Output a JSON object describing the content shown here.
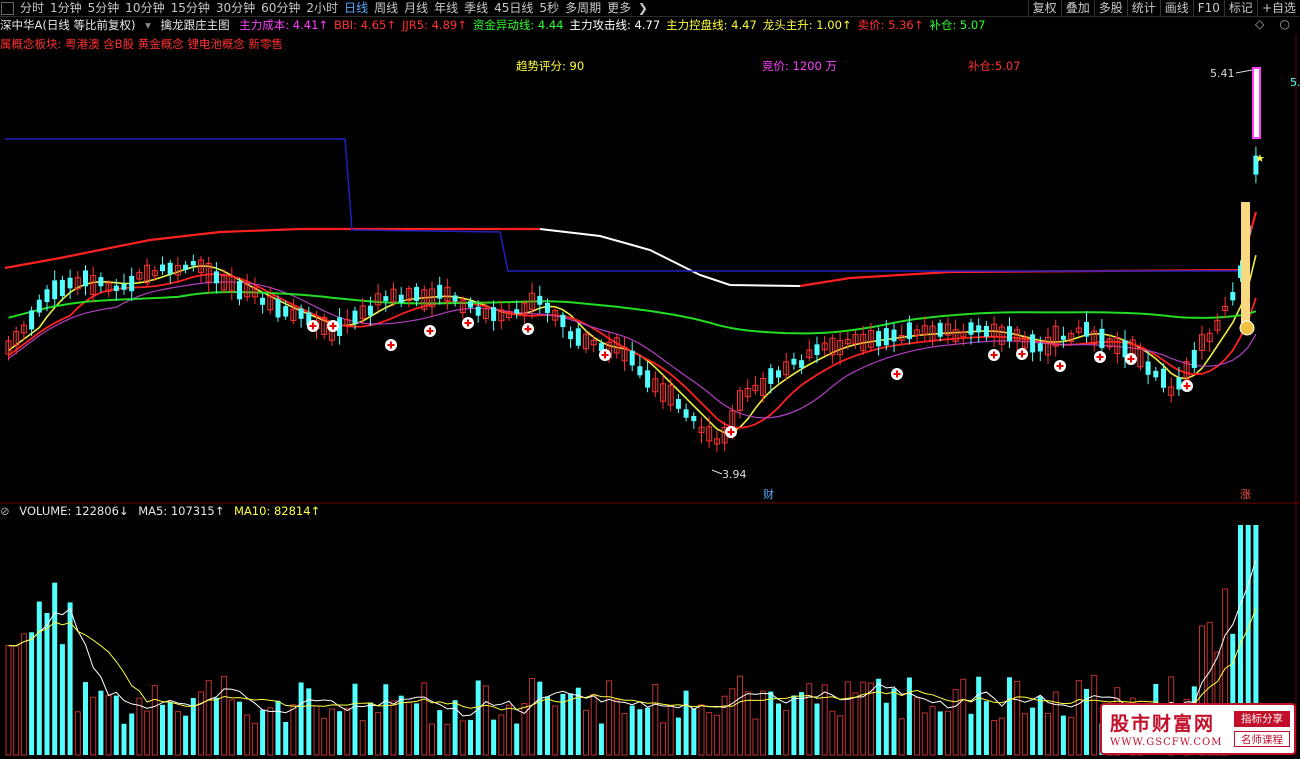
{
  "toolbar": {
    "periods": [
      {
        "label": "分时"
      },
      {
        "label": "1分钟"
      },
      {
        "label": "5分钟"
      },
      {
        "label": "10分钟"
      },
      {
        "label": "15分钟"
      },
      {
        "label": "30分钟"
      },
      {
        "label": "60分钟"
      },
      {
        "label": "2小时"
      },
      {
        "label": "日线"
      },
      {
        "label": "周线"
      },
      {
        "label": "月线"
      },
      {
        "label": "年线"
      },
      {
        "label": "季线"
      },
      {
        "label": "45日线"
      },
      {
        "label": "5秒"
      },
      {
        "label": "多周期"
      },
      {
        "label": "更多"
      }
    ],
    "active_period": "日线",
    "right_buttons": [
      "复权",
      "叠加",
      "多股",
      "统计",
      "画线",
      "F10",
      "标记",
      "+自选"
    ]
  },
  "info": {
    "stock": "深中华A(日线 等比前复权)",
    "indicator_name": "擒龙跟庄主图",
    "items": [
      {
        "label": "主力成本: 4.41↑",
        "color": "#ff40ff"
      },
      {
        "label": "BBI: 4.65↑",
        "color": "#ff3030"
      },
      {
        "label": "JJR5: 4.89↑",
        "color": "#ff3030"
      },
      {
        "label": "资金异动线: 4.44",
        "color": "#30ff30"
      },
      {
        "label": "主力攻击线: 4.77",
        "color": "#ffffff"
      },
      {
        "label": "主力控盘线: 4.47",
        "color": "#ffff40"
      },
      {
        "label": "龙头主升: 1.00↑",
        "color": "#ffff40"
      },
      {
        "label": "卖价: 5.36↑",
        "color": "#ff3030"
      },
      {
        "label": "补仓: 5.07",
        "color": "#30ff30"
      }
    ]
  },
  "concept_line": "属概念板块:  粤港澳 含B股 黄金概念 锂电池概念 新零售",
  "scores": {
    "trend": "趋势评分:  90",
    "bid": "竞价: 1200 万",
    "buy_add": "补仓:5.07"
  },
  "price_labels": {
    "high": "5.41",
    "low": "3.94",
    "right_edge": "5."
  },
  "markers": {
    "cai": "财",
    "zhang": "涨"
  },
  "volume": {
    "label": "VOLUME: 122806↓",
    "ma5": "MA5: 107315↑",
    "ma10": "MA10: 82814↑"
  },
  "watermark": {
    "main": "股市财富网",
    "url": "WWW.GSCFW.COM",
    "tag1": "指标分享",
    "tag2": "名师课程"
  },
  "colors": {
    "up": "#ff3232",
    "down": "#54ffff",
    "ma_red": "#ff2020",
    "ma_blue": "#1a1aa0",
    "ma_green": "#22dd22",
    "ma_yellow": "#f0f040",
    "ma_purple": "#b040c0",
    "ma_white": "#ffffff"
  }
}
